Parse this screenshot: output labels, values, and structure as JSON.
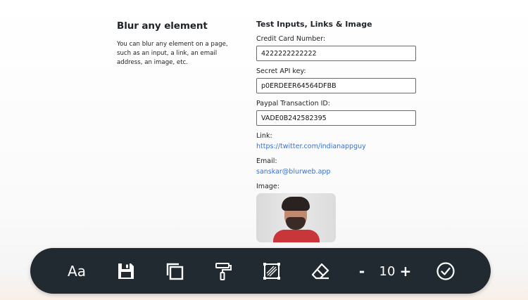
{
  "left": {
    "title": "Blur any element",
    "description": "You can blur any element on a page, such as an input, a link, an email address, an image, etc."
  },
  "right": {
    "title": "Test Inputs, Links & Image",
    "fields": [
      {
        "label": "Credit Card Number:",
        "value": "4222222222222"
      },
      {
        "label": "Secret API key:",
        "value": "p0ERDEER64564DFBB"
      },
      {
        "label": "Paypal Transaction ID:",
        "value": "VADE0B242582395"
      }
    ],
    "link_label": "Link:",
    "link_text": "https://twitter.com/indianappguy",
    "email_label": "Email:",
    "email_text": "sanskar@blurweb.app",
    "image_label": "Image:"
  },
  "toolbar": {
    "text_tool_label": "Aa",
    "decrement_label": "-",
    "blur_value": "10",
    "increment_label": "+",
    "icons": [
      "text-icon",
      "save-icon",
      "copy-icon",
      "paint-roller-icon",
      "select-area-icon",
      "eraser-icon",
      "check-circle-icon"
    ]
  },
  "colors": {
    "toolbar_bg": "#202a30",
    "link": "#3a6fd1"
  }
}
